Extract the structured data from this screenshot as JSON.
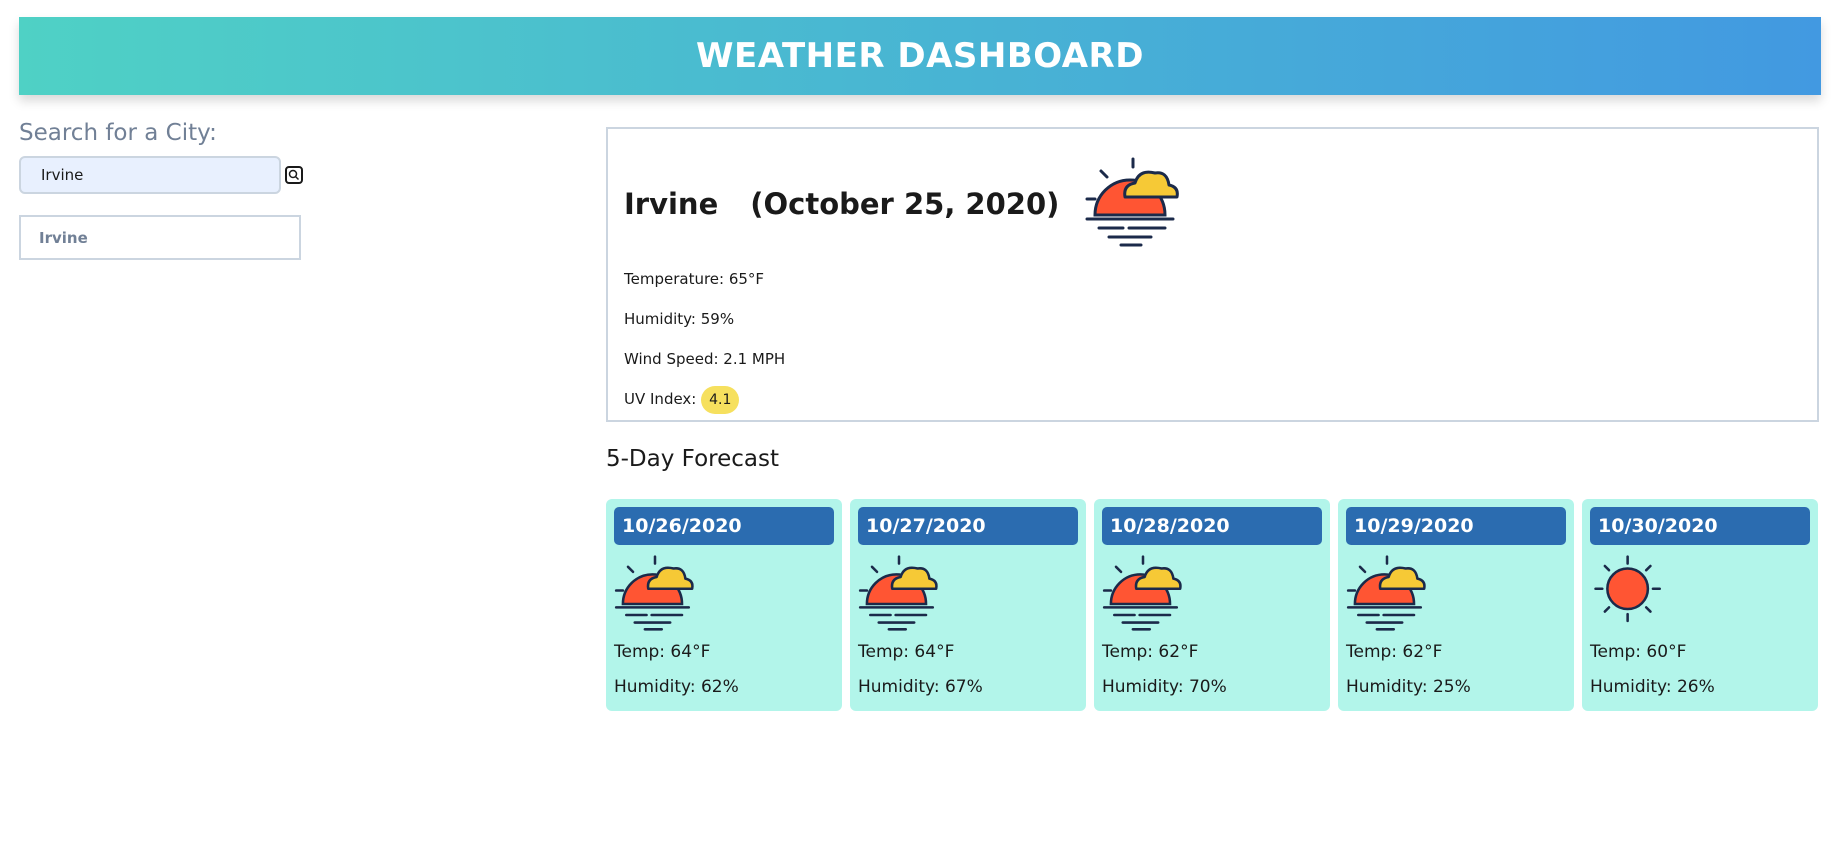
{
  "header": {
    "title": "WEATHER DASHBOARD"
  },
  "search": {
    "label": "Search for a City:",
    "value": "Irvine",
    "button_icon": "search-icon"
  },
  "history": {
    "items": [
      {
        "label": "Irvine"
      }
    ]
  },
  "current": {
    "city": "Irvine",
    "date": "(October 25, 2020)",
    "icon": "cloudy-sunset-icon",
    "temperature": "Temperature: 65°F",
    "humidity": "Humidity: 59%",
    "wind": "Wind Speed: 2.1 MPH",
    "uv_label": "UV Index:",
    "uv_value": "4.1"
  },
  "forecast": {
    "title": "5-Day Forecast",
    "days": [
      {
        "date": "10/26/2020",
        "icon": "cloudy-sunset-icon",
        "temp": "Temp: 64°F",
        "humidity": "Humidity: 62%"
      },
      {
        "date": "10/27/2020",
        "icon": "cloudy-sunset-icon",
        "temp": "Temp: 64°F",
        "humidity": "Humidity: 67%"
      },
      {
        "date": "10/28/2020",
        "icon": "cloudy-sunset-icon",
        "temp": "Temp: 62°F",
        "humidity": "Humidity: 70%"
      },
      {
        "date": "10/29/2020",
        "icon": "cloudy-sunset-icon",
        "temp": "Temp: 62°F",
        "humidity": "Humidity: 25%"
      },
      {
        "date": "10/30/2020",
        "icon": "sun-icon",
        "temp": "Temp: 60°F",
        "humidity": "Humidity: 26%"
      }
    ]
  },
  "colors": {
    "header_gradient_start": "#4fd1c5",
    "header_gradient_end": "#4299e1",
    "card_background": "#b2f5ea",
    "date_badge": "#2b6cb0",
    "uv_badge": "#f6e05e",
    "sun": "#ff5533",
    "cloud": "#f6c936"
  }
}
